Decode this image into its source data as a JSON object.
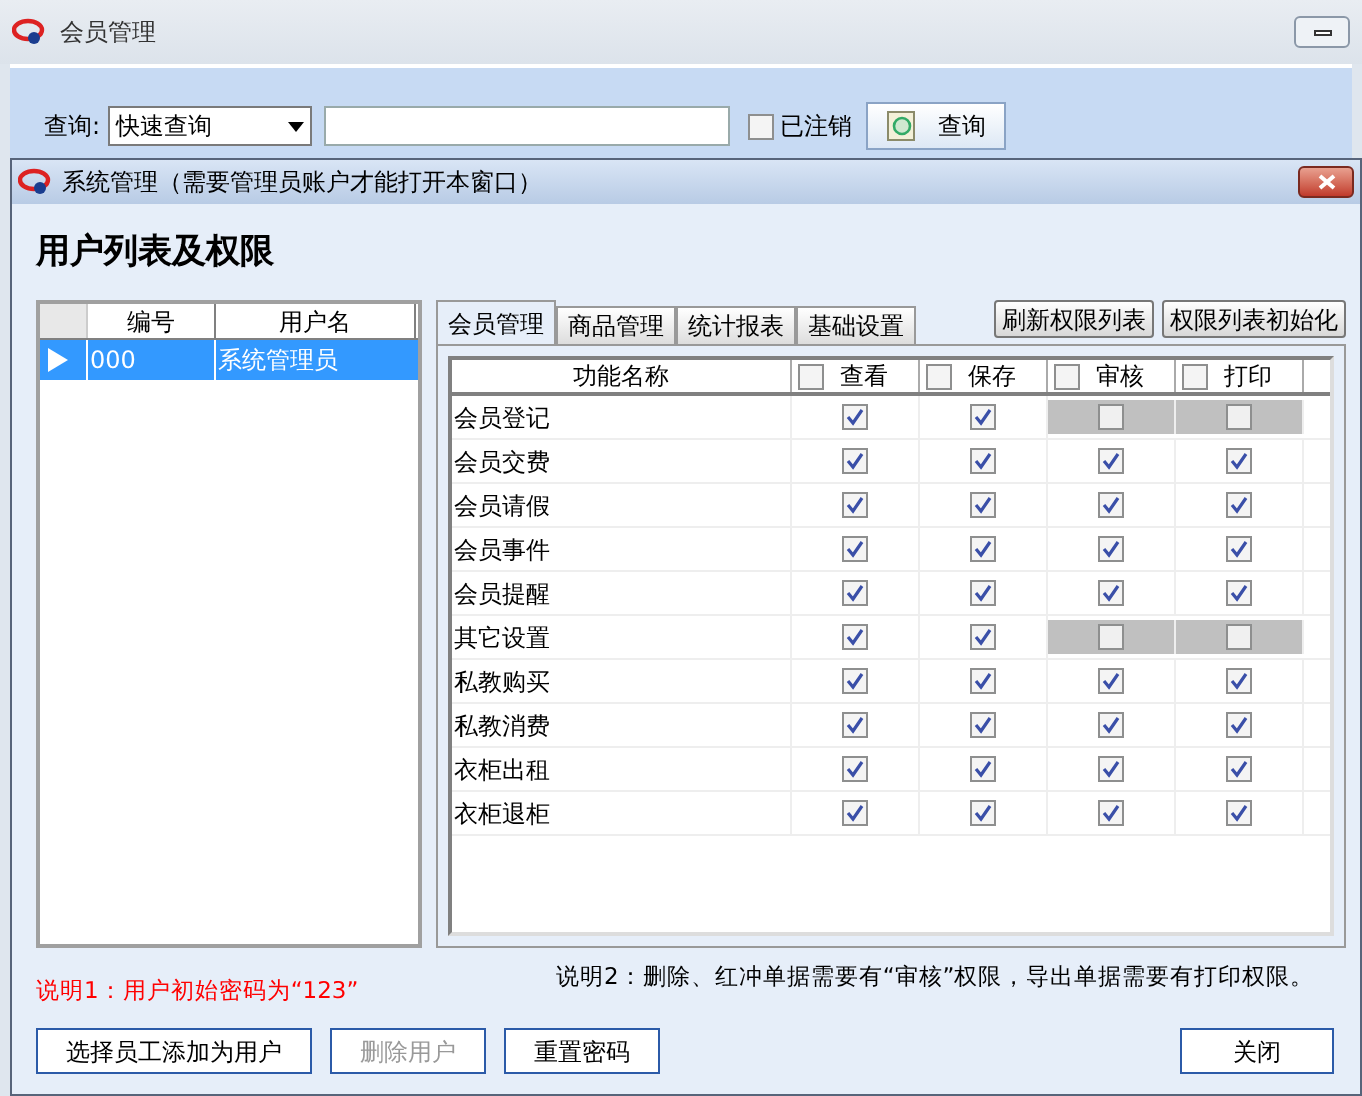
{
  "window": {
    "title": "会员管理"
  },
  "query": {
    "label": "查询:",
    "mode": "快速查询",
    "cancelled_label": "已注销",
    "cancelled": false,
    "button": "查询"
  },
  "dialog": {
    "title": "系统管理（需要管理员账户才能打开本窗口）",
    "heading": "用户列表及权限"
  },
  "users": {
    "columns": [
      "编号",
      "用户名"
    ],
    "rows": [
      {
        "id": "000",
        "name": "系统管理员",
        "selected": true
      }
    ]
  },
  "tabs": [
    {
      "label": "会员管理",
      "selected": true
    },
    {
      "label": "商品管理",
      "selected": false
    },
    {
      "label": "统计报表",
      "selected": false
    },
    {
      "label": "基础设置",
      "selected": false
    }
  ],
  "actions": [
    "刷新权限列表",
    "权限列表初始化"
  ],
  "permissions": {
    "name_column": "功能名称",
    "columns": [
      {
        "label": "查看",
        "checked": false
      },
      {
        "label": "保存",
        "checked": false
      },
      {
        "label": "审核",
        "checked": false
      },
      {
        "label": "打印",
        "checked": false
      }
    ],
    "rows": [
      {
        "name": "会员登记",
        "cells": [
          {
            "checked": true,
            "disabled": false
          },
          {
            "checked": true,
            "disabled": false
          },
          {
            "checked": false,
            "disabled": true
          },
          {
            "checked": false,
            "disabled": true
          }
        ]
      },
      {
        "name": "会员交费",
        "cells": [
          {
            "checked": true,
            "disabled": false
          },
          {
            "checked": true,
            "disabled": false
          },
          {
            "checked": true,
            "disabled": false
          },
          {
            "checked": true,
            "disabled": false
          }
        ]
      },
      {
        "name": "会员请假",
        "cells": [
          {
            "checked": true,
            "disabled": false
          },
          {
            "checked": true,
            "disabled": false
          },
          {
            "checked": true,
            "disabled": false
          },
          {
            "checked": true,
            "disabled": false
          }
        ]
      },
      {
        "name": "会员事件",
        "cells": [
          {
            "checked": true,
            "disabled": false
          },
          {
            "checked": true,
            "disabled": false
          },
          {
            "checked": true,
            "disabled": false
          },
          {
            "checked": true,
            "disabled": false
          }
        ]
      },
      {
        "name": "会员提醒",
        "cells": [
          {
            "checked": true,
            "disabled": false
          },
          {
            "checked": true,
            "disabled": false
          },
          {
            "checked": true,
            "disabled": false
          },
          {
            "checked": true,
            "disabled": false
          }
        ]
      },
      {
        "name": "其它设置",
        "cells": [
          {
            "checked": true,
            "disabled": false
          },
          {
            "checked": true,
            "disabled": false
          },
          {
            "checked": false,
            "disabled": true
          },
          {
            "checked": false,
            "disabled": true
          }
        ]
      },
      {
        "name": "私教购买",
        "cells": [
          {
            "checked": true,
            "disabled": false
          },
          {
            "checked": true,
            "disabled": false
          },
          {
            "checked": true,
            "disabled": false
          },
          {
            "checked": true,
            "disabled": false
          }
        ]
      },
      {
        "name": "私教消费",
        "cells": [
          {
            "checked": true,
            "disabled": false
          },
          {
            "checked": true,
            "disabled": false
          },
          {
            "checked": true,
            "disabled": false
          },
          {
            "checked": true,
            "disabled": false
          }
        ]
      },
      {
        "name": "衣柜出租",
        "cells": [
          {
            "checked": true,
            "disabled": false
          },
          {
            "checked": true,
            "disabled": false
          },
          {
            "checked": true,
            "disabled": false
          },
          {
            "checked": true,
            "disabled": false
          }
        ]
      },
      {
        "name": "衣柜退柜",
        "cells": [
          {
            "checked": true,
            "disabled": false
          },
          {
            "checked": true,
            "disabled": false
          },
          {
            "checked": true,
            "disabled": false
          },
          {
            "checked": true,
            "disabled": false
          }
        ]
      }
    ]
  },
  "notes": [
    "说明1：用户初始密码为“123”",
    "说明2：删除、红冲单据需要有“审核”权限，导出单据需要有打印权限。"
  ],
  "buttons": [
    {
      "label": "选择员工添加为用户",
      "disabled": false
    },
    {
      "label": "删除用户",
      "disabled": true
    },
    {
      "label": "重置密码",
      "disabled": false
    },
    {
      "label": "关闭",
      "disabled": false
    }
  ]
}
